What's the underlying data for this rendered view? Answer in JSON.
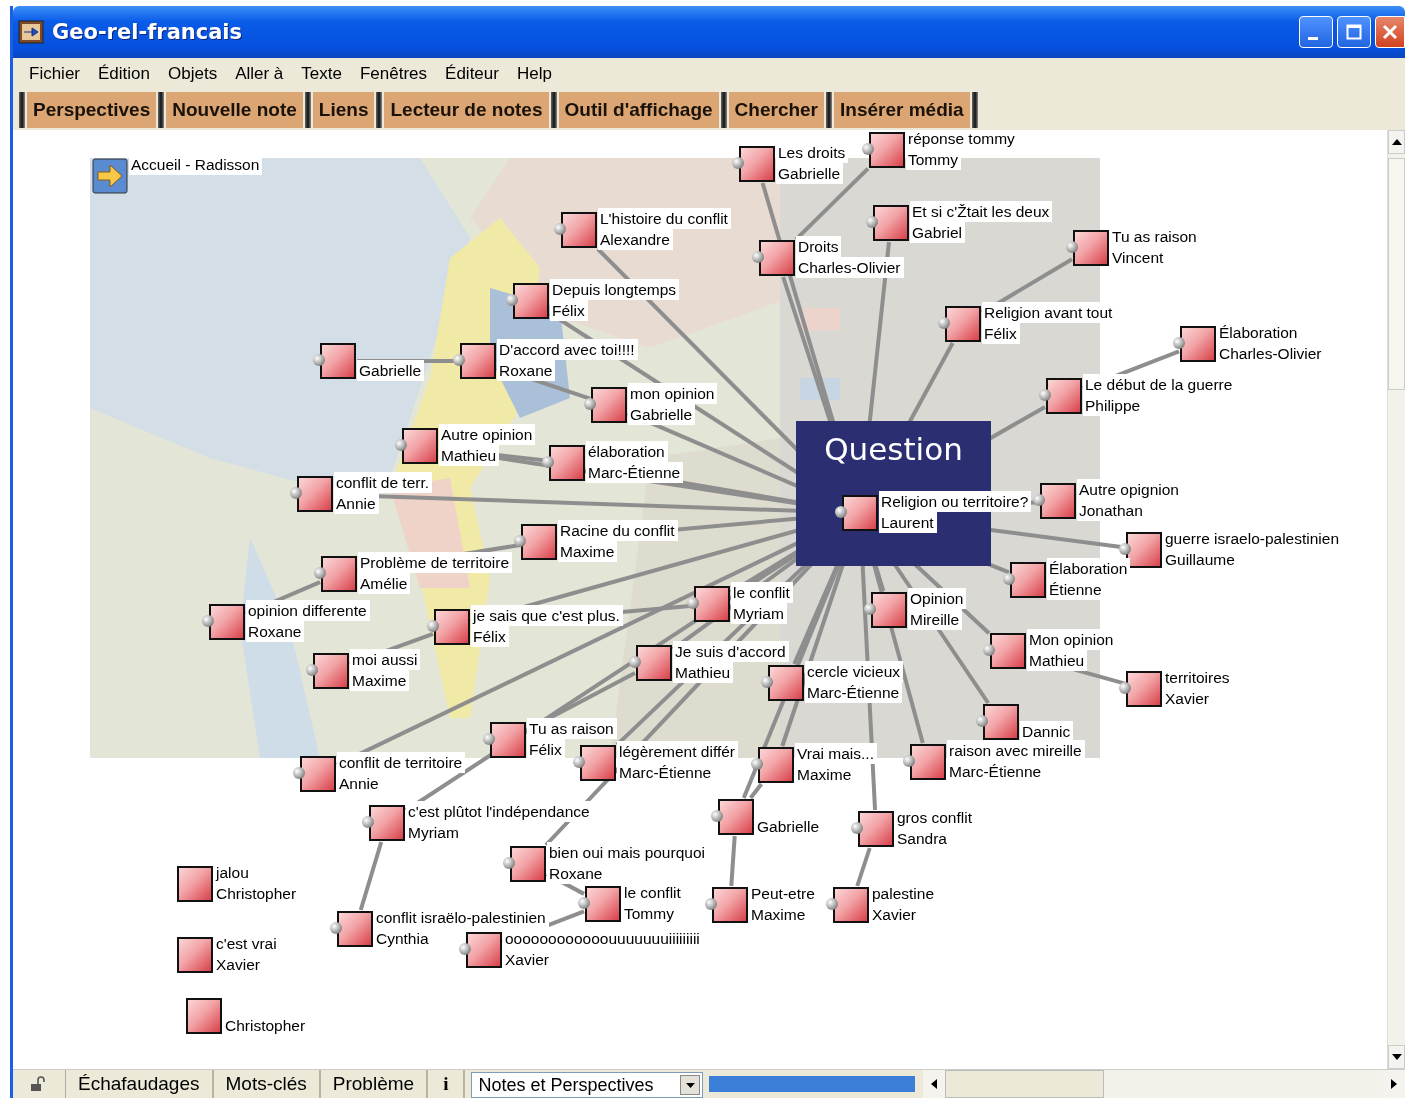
{
  "window": {
    "title": "Geo-rel-francais"
  },
  "menu": [
    "Fichier",
    "Édition",
    "Objets",
    "Aller à",
    "Texte",
    "Fenêtres",
    "Éditeur",
    "Help"
  ],
  "toolbar": [
    "Perspectives",
    "Nouvelle note",
    "Liens",
    "Lecteur de notes",
    "Outil d'affichage",
    "Chercher",
    "Insérer média"
  ],
  "home_link": {
    "label": "Accueil - Radisson"
  },
  "question_banner": "Question",
  "notes": [
    {
      "title": "Les droits",
      "author": "Gabrielle",
      "connector": true
    },
    {
      "title": "réponse tommy",
      "author": "Tommy",
      "connector": true
    },
    {
      "title": "L'histoire du conflit",
      "author": "Alexandre",
      "connector": true
    },
    {
      "title": "Et si c'Žtait les deux",
      "author": "Gabriel",
      "connector": true
    },
    {
      "title": "Droits",
      "author": "Charles-Olivier",
      "connector": true
    },
    {
      "title": "Tu as raison",
      "author": "Vincent",
      "connector": true
    },
    {
      "title": "Depuis longtemps",
      "author": "Félix",
      "connector": true
    },
    {
      "title": "Religion avant tout",
      "author": "Félix",
      "connector": true
    },
    {
      "title": "Élaboration",
      "author": "Charles-Olivier",
      "connector": true
    },
    {
      "author": "Gabrielle",
      "connector": true
    },
    {
      "title": "D'accord avec toi!!!!",
      "author": "Roxane",
      "connector": true
    },
    {
      "title": "mon opinion",
      "author": "Gabrielle",
      "connector": true
    },
    {
      "title": "Le début de la guerre",
      "author": "Philippe",
      "connector": true
    },
    {
      "title": "Autre opinion",
      "author": "Mathieu",
      "connector": true
    },
    {
      "title": "élaboration",
      "author": "Marc-Étienne",
      "connector": true
    },
    {
      "title": "conflit de terr.",
      "author": "Annie",
      "connector": true
    },
    {
      "title": "Religion ou territoire?",
      "author": "Laurent",
      "connector": true
    },
    {
      "title": "Autre opignion",
      "author": "Jonathan",
      "connector": true
    },
    {
      "title": "Racine du conflit",
      "author": "Maxime",
      "connector": true
    },
    {
      "title": "guerre israelo-palestinien",
      "author": "Guillaume",
      "connector": true
    },
    {
      "title": "Problème de territoire",
      "author": "Amélie",
      "connector": true
    },
    {
      "title": "Élaboration",
      "author": "Étienne",
      "connector": true
    },
    {
      "title": "le conflit",
      "author": "Myriam",
      "connector": true
    },
    {
      "title": "Opinion",
      "author": "Mireille",
      "connector": true
    },
    {
      "title": "opinion differente",
      "author": "Roxane",
      "connector": true
    },
    {
      "title": "je sais que c'est plus.",
      "author": "Félix",
      "connector": true
    },
    {
      "title": "Mon opinion",
      "author": "Mathieu",
      "connector": true
    },
    {
      "title": "moi aussi",
      "author": "Maxime",
      "connector": true
    },
    {
      "title": "Je suis d'accord",
      "author": "Mathieu",
      "connector": true
    },
    {
      "title": "cercle vicieux",
      "author": "Marc-Étienne",
      "connector": true
    },
    {
      "title": "territoires",
      "author": "Xavier",
      "connector": true
    },
    {
      "author": "Dannic",
      "connector": true
    },
    {
      "title": "Tu as raison",
      "author": "Félix",
      "connector": true
    },
    {
      "title": "conflit de territoire",
      "author": "Annie",
      "connector": true
    },
    {
      "title": "légèrement différ",
      "author": "Marc-Étienne",
      "connector": true
    },
    {
      "title": "Vrai mais...",
      "author": "Maxime",
      "connector": true
    },
    {
      "title": "raison avec mireille",
      "author": "Marc-Étienne",
      "connector": true
    },
    {
      "title": "c'est plûtot l'indépendance",
      "author": "Myriam",
      "connector": true
    },
    {
      "author": "Gabrielle",
      "connector": true
    },
    {
      "title": "gros conflit",
      "author": "Sandra",
      "connector": true
    },
    {
      "title": "bien oui mais pourquoi",
      "author": "Roxane",
      "connector": true
    },
    {
      "title": "jalou",
      "author": "Christopher",
      "connector": false
    },
    {
      "title": "Peut-etre",
      "author": "Maxime",
      "connector": true
    },
    {
      "title": "palestine",
      "author": "Xavier",
      "connector": true
    },
    {
      "title": "conflit israëlo-palestinien",
      "author": "Cynthia",
      "connector": true
    },
    {
      "title": "le conflit",
      "author": "Tommy",
      "connector": true
    },
    {
      "title": "c'est vrai",
      "author": "Xavier",
      "connector": false
    },
    {
      "title": "oooooooooooouuuuuuuiiiiiiiii",
      "author": "Xavier",
      "connector": true
    },
    {
      "author": "Christopher",
      "connector": false
    }
  ],
  "bottom_tabs": [
    "Échafaudages",
    "Mots-clés",
    "Problème"
  ],
  "info_button": "i",
  "view_dropdown": {
    "value": "Notes et Perspectives"
  },
  "progress": {
    "level": 1
  }
}
